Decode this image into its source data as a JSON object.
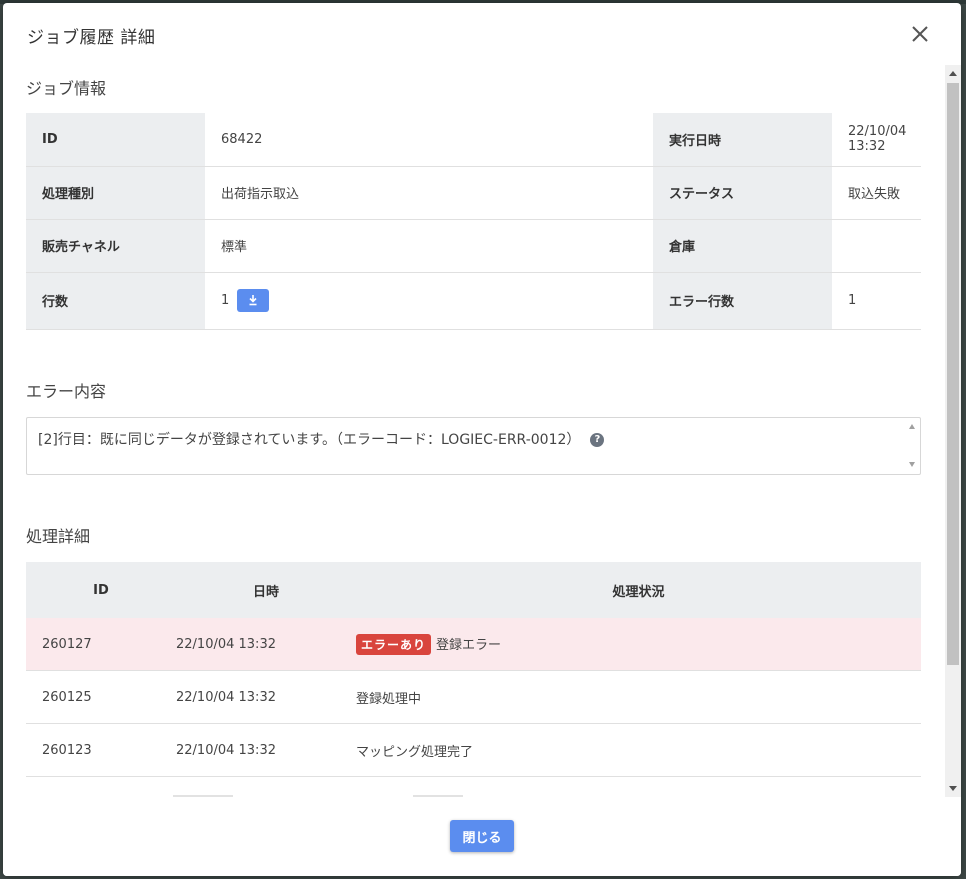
{
  "modal": {
    "title": "ジョブ履歴 詳細"
  },
  "job_info": {
    "section_title": "ジョブ情報",
    "rows": [
      {
        "label1": "ID",
        "value1": "68422",
        "label2": "実行日時",
        "value2": "22/10/04 13:32"
      },
      {
        "label1": "処理種別",
        "value1": "出荷指示取込",
        "label2": "ステータス",
        "value2": "取込失敗"
      },
      {
        "label1": "販売チャネル",
        "value1": "標準",
        "label2": "倉庫",
        "value2": ""
      },
      {
        "label1": "行数",
        "value1": "1",
        "label2": "エラー行数",
        "value2": "1"
      }
    ]
  },
  "error": {
    "section_title": "エラー内容",
    "message": "[2]行目：既に同じデータが登録されています。（エラーコード：LOGIEC-ERR-0012）",
    "help_glyph": "?"
  },
  "details": {
    "section_title": "処理詳細",
    "headers": {
      "id": "ID",
      "datetime": "日時",
      "status": "処理状況"
    },
    "rows": [
      {
        "id": "260127",
        "datetime": "22/10/04 13:32",
        "badge": "エラーあり",
        "status": "登録エラー"
      },
      {
        "id": "260125",
        "datetime": "22/10/04 13:32",
        "status": "登録処理中"
      },
      {
        "id": "260123",
        "datetime": "22/10/04 13:32",
        "status": "マッピング処理完了"
      }
    ]
  },
  "footer": {
    "close_label": "閉じる"
  },
  "colors": {
    "accent": "#5b8def",
    "error_badge": "#d9453d",
    "error_row": "#fbe9ec",
    "label_bg": "#eceef0"
  }
}
